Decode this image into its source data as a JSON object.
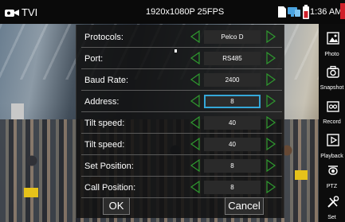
{
  "status_bar": {
    "source_label": "TVI",
    "resolution": "1920x1080P 25FPS",
    "time": "1:36 AM",
    "icons": [
      "camera-icon",
      "sd-card-icon",
      "network-icon",
      "battery-icon"
    ],
    "rec_color": "#d0202a"
  },
  "sidebar": {
    "items": [
      {
        "label": "Photo",
        "icon": "image-icon"
      },
      {
        "label": "Snapshot",
        "icon": "camera-icon"
      },
      {
        "label": "Record",
        "icon": "record-icon"
      },
      {
        "label": "Playback",
        "icon": "play-icon"
      },
      {
        "label": "PTZ",
        "icon": "ptz-icon"
      },
      {
        "label": "Set",
        "icon": "tools-icon"
      }
    ]
  },
  "settings": {
    "accent_color": "#35a7d8",
    "arrow_color": "#2f9a2f",
    "rows": [
      {
        "label": "Protocols:",
        "value": "Pelco D"
      },
      {
        "label": "Port:",
        "value": "RS485"
      },
      {
        "label": "Baud Rate:",
        "value": "2400"
      },
      {
        "label": "Address:",
        "value": "8",
        "active": true
      },
      {
        "label": "Tilt speed:",
        "value": "40"
      },
      {
        "label": "Tilt speed:",
        "value": "40"
      },
      {
        "label": "Set Position:",
        "value": "8"
      },
      {
        "label": "Call Position:",
        "value": "8"
      }
    ],
    "ok_label": "OK",
    "cancel_label": "Cancel"
  }
}
